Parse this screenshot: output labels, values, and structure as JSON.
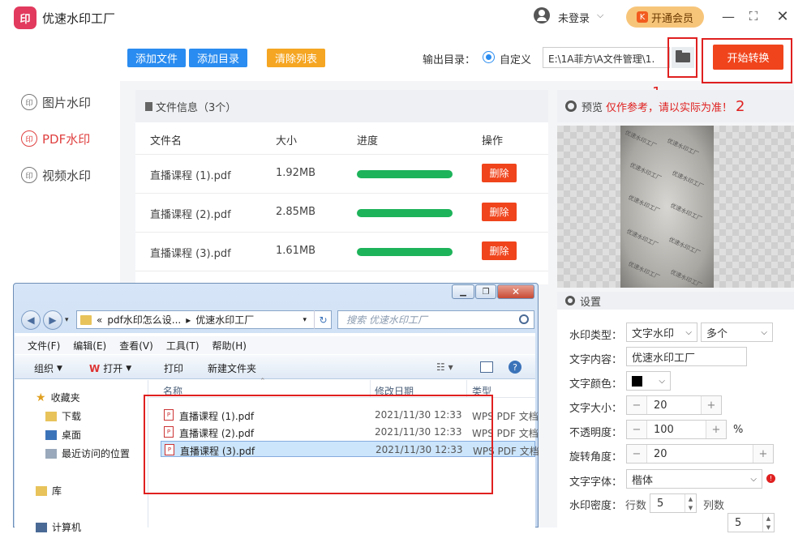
{
  "app": {
    "title": "优速水印工厂",
    "logo_text": "印",
    "login_text": "未登录",
    "vip_label": "开通会员",
    "vip_icon": "K",
    "colors": {
      "accent": "#f0441c",
      "blue": "#2a8cf0",
      "orange": "#f5a623",
      "green": "#1db35a",
      "active": "#e04040"
    }
  },
  "sidebar": {
    "items": [
      {
        "label": "图片水印",
        "icon": "印"
      },
      {
        "label": "PDF水印",
        "icon": "印"
      },
      {
        "label": "视频水印",
        "icon": "印"
      }
    ]
  },
  "toolbar": {
    "add_file": "添加文件",
    "add_folder": "添加目录",
    "clear_list": "清除列表",
    "output_label": "输出目录：",
    "custom_label": "自定义",
    "output_path": "E:\\1A菲方\\A文件管理\\1.",
    "start_label": "开始转换"
  },
  "annotations": {
    "n1": "1",
    "n2": "2"
  },
  "file_panel": {
    "title": "文件信息（3个）",
    "columns": [
      "文件名",
      "大小",
      "进度",
      "操作"
    ],
    "rows": [
      {
        "name": "直播课程 (1).pdf",
        "size": "1.92MB",
        "progress": 1.0,
        "action": "删除"
      },
      {
        "name": "直播课程 (2).pdf",
        "size": "2.85MB",
        "progress": 1.0,
        "action": "删除"
      },
      {
        "name": "直播课程 (3).pdf",
        "size": "1.61MB",
        "progress": 1.0,
        "action": "删除"
      }
    ]
  },
  "preview": {
    "label": "预览",
    "note": "仅作参考，请以实际为准！",
    "watermark_text": "优速水印工厂"
  },
  "settings": {
    "title": "设置",
    "wm_type_label": "水印类型：",
    "wm_type_value": "文字水印",
    "wm_count_value": "多个",
    "text_content_label": "文字内容：",
    "text_content_value": "优速水印工厂",
    "text_color_label": "文字颜色：",
    "text_color_value": "#000000",
    "text_size_label": "文字大小：",
    "text_size_value": "20",
    "opacity_label": "不透明度：",
    "opacity_value": "100",
    "opacity_unit": "%",
    "rotation_label": "旋转角度：",
    "rotation_value": "20",
    "font_label": "文字字体：",
    "font_value": "楷体",
    "density_label": "水印密度：",
    "rows_label": "行数",
    "rows_value": "5",
    "cols_label": "列数",
    "cols_value": "5",
    "minus": "−",
    "plus": "+"
  },
  "explorer": {
    "address_parts": [
      "«",
      "pdf水印怎么设...",
      "▸",
      "优速水印工厂"
    ],
    "search_placeholder": "搜索 优速水印工厂",
    "menu": [
      "文件(F)",
      "编辑(E)",
      "查看(V)",
      "工具(T)",
      "帮助(H)"
    ],
    "commands": {
      "organize": "组织",
      "open": "打开",
      "print": "打印",
      "new_folder": "新建文件夹"
    },
    "nav": {
      "favorites": "收藏夹",
      "downloads": "下载",
      "desktop": "桌面",
      "recent": "最近访问的位置",
      "library": "库",
      "computer": "计算机"
    },
    "columns": {
      "name": "名称",
      "date": "修改日期",
      "type": "类型"
    },
    "files": [
      {
        "name": "直播课程 (1).pdf",
        "date": "2021/11/30 12:33",
        "type": "WPS PDF 文档"
      },
      {
        "name": "直播课程 (2).pdf",
        "date": "2021/11/30 12:33",
        "type": "WPS PDF 文档"
      },
      {
        "name": "直播课程 (3).pdf",
        "date": "2021/11/30 12:33",
        "type": "WPS PDF 文档"
      }
    ]
  }
}
